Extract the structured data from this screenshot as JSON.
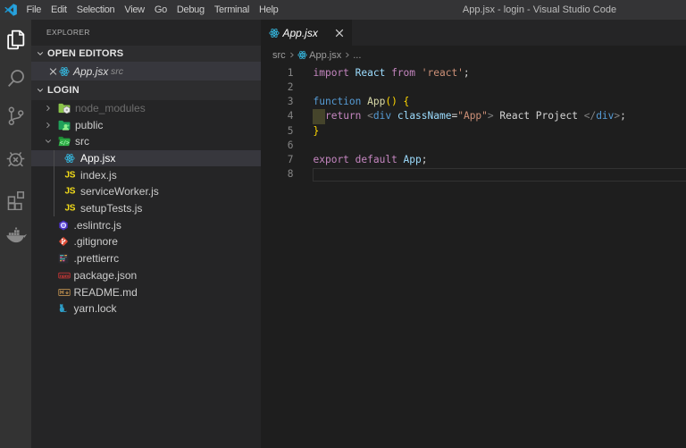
{
  "colors": {
    "titlebar": "#343436",
    "activitybar": "#333333",
    "sidebar": "#252526",
    "editor": "#1e1e1e",
    "tabbar": "#252526",
    "selection_row": "#37373d",
    "react_icon": "#35b5dc",
    "js_icon": "#F5DE19",
    "eslint_icon": "#4B32C3",
    "git_icon": "#DE4C36",
    "npm_icon": "#C53635",
    "yarn_icon": "#2E9CC5",
    "folder_green": "#8BC34A",
    "cursor_block": "#45442b"
  },
  "titlebar": {
    "menus": [
      "File",
      "Edit",
      "Selection",
      "View",
      "Go",
      "Debug",
      "Terminal",
      "Help"
    ],
    "title": "App.jsx - login - Visual Studio Code"
  },
  "activitybar": {
    "items": [
      "explorer",
      "search",
      "source-control",
      "debug",
      "extensions",
      "docker"
    ]
  },
  "sidebar": {
    "title": "EXPLORER",
    "open_editors": {
      "header": "OPEN EDITORS",
      "items": [
        {
          "label": "App.jsx",
          "description": "src",
          "icon": "react"
        }
      ]
    },
    "project": {
      "header": "LOGIN",
      "tree": [
        {
          "label": "node_modules",
          "icon": "folder-node",
          "level": 0,
          "collapsed": true,
          "dimmed": true
        },
        {
          "label": "public",
          "icon": "folder-public",
          "level": 0,
          "collapsed": true
        },
        {
          "label": "src",
          "icon": "folder-src-open",
          "level": 0,
          "expanded": true
        },
        {
          "label": "App.jsx",
          "icon": "react",
          "level": 1,
          "selected": true
        },
        {
          "label": "index.js",
          "icon": "js",
          "level": 1
        },
        {
          "label": "serviceWorker.js",
          "icon": "js",
          "level": 1
        },
        {
          "label": "setupTests.js",
          "icon": "js",
          "level": 1
        },
        {
          "label": ".eslintrc.js",
          "icon": "eslint",
          "level": 0
        },
        {
          "label": ".gitignore",
          "icon": "git",
          "level": 0
        },
        {
          "label": ".prettierrc",
          "icon": "prettier",
          "level": 0
        },
        {
          "label": "package.json",
          "icon": "npm",
          "level": 0
        },
        {
          "label": "README.md",
          "icon": "readme",
          "level": 0
        },
        {
          "label": "yarn.lock",
          "icon": "yarn",
          "level": 0
        }
      ]
    },
    "js_badge": "JS"
  },
  "editor": {
    "tab": {
      "label": "App.jsx",
      "icon": "react",
      "close": "×"
    },
    "breadcrumb": {
      "items": [
        "src",
        "App.jsx",
        "..."
      ]
    },
    "code": {
      "token_colors": {
        "kw": "#C586C0",
        "st": "#569CD6",
        "fn": "#DCDCAA",
        "var": "#9CDCFE",
        "str": "#CE9178",
        "pl": "#D4D4D4",
        "br": "#FFD700",
        "pn": "#808080"
      },
      "lines": [
        {
          "n": "1",
          "tokens": [
            {
              "t": "import ",
              "c": "kw"
            },
            {
              "t": "React ",
              "c": "var"
            },
            {
              "t": "from ",
              "c": "kw"
            },
            {
              "t": "'react'",
              "c": "str"
            },
            {
              "t": ";",
              "c": "pl"
            }
          ]
        },
        {
          "n": "2",
          "tokens": []
        },
        {
          "n": "3",
          "tokens": [
            {
              "t": "function ",
              "c": "st"
            },
            {
              "t": "App",
              "c": "fn"
            },
            {
              "t": "() {",
              "c": "br"
            }
          ]
        },
        {
          "n": "4",
          "tokens": [
            {
              "t": "  ",
              "c": "pl"
            },
            {
              "t": "return ",
              "c": "kw"
            },
            {
              "t": "<",
              "c": "pn"
            },
            {
              "t": "div ",
              "c": "st"
            },
            {
              "t": "className",
              "c": "var"
            },
            {
              "t": "=",
              "c": "pl"
            },
            {
              "t": "\"App\"",
              "c": "str"
            },
            {
              "t": ">",
              "c": "pn"
            },
            {
              "t": " React Project ",
              "c": "pl"
            },
            {
              "t": "</",
              "c": "pn"
            },
            {
              "t": "div",
              "c": "st"
            },
            {
              "t": ">",
              "c": "pn"
            },
            {
              "t": ";",
              "c": "pl"
            }
          ]
        },
        {
          "n": "5",
          "tokens": [
            {
              "t": "}",
              "c": "br"
            }
          ]
        },
        {
          "n": "6",
          "tokens": []
        },
        {
          "n": "7",
          "tokens": [
            {
              "t": "export ",
              "c": "kw"
            },
            {
              "t": "default ",
              "c": "kw"
            },
            {
              "t": "App",
              "c": "var"
            },
            {
              "t": ";",
              "c": "pl"
            }
          ]
        },
        {
          "n": "8",
          "tokens": []
        }
      ]
    }
  }
}
